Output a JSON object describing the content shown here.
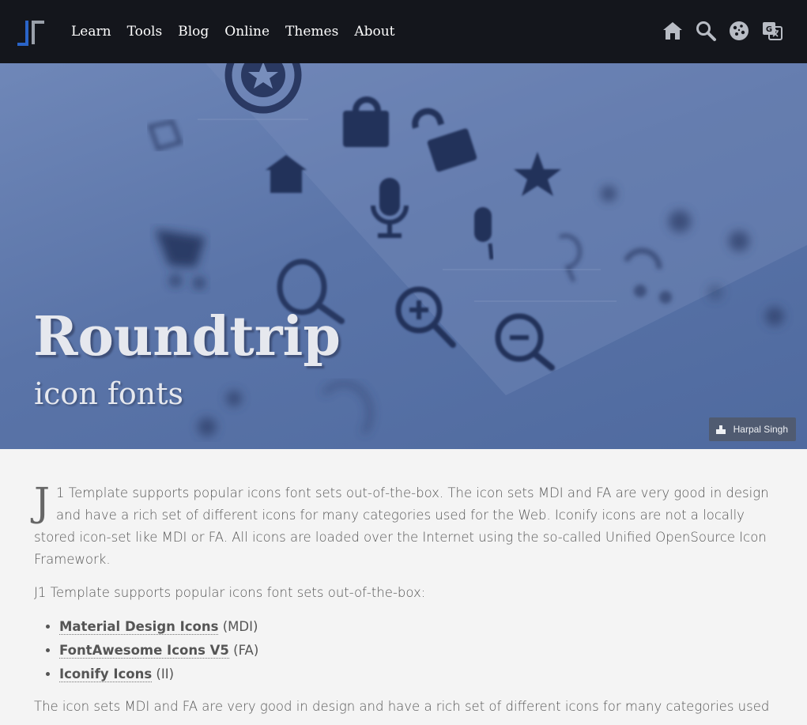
{
  "nav": {
    "links": [
      "Learn",
      "Tools",
      "Blog",
      "Online",
      "Themes",
      "About"
    ],
    "icons": [
      "home-icon",
      "search-icon",
      "cookie-icon",
      "translate-icon"
    ]
  },
  "hero": {
    "title": "Roundtrip",
    "subtitle": "icon fonts",
    "credit": "Harpal Singh"
  },
  "content": {
    "intro_dropcap": "J",
    "intro_rest": "1 Template supports popular icons font sets out-of-the-box. The icon sets MDI and FA are very good in design and have a rich set of different icons for many categories used for the Web. Iconify icons are not a locally stored icon-set like MDI or FA. All icons are loaded over the Internet using the so-called Unified OpenSource Icon Framework.",
    "para2": "J1 Template supports popular icons font sets out-of-the-box:",
    "list": [
      {
        "link": "Material Design Icons",
        "abbr": "(MDI)"
      },
      {
        "link": "FontAwesome Icons V5",
        "abbr": "(FA)"
      },
      {
        "link": "Iconify Icons",
        "abbr": "(II)"
      }
    ],
    "para3": "The icon sets MDI and FA are very good in design and have a rich set of different icons for many categories used"
  },
  "colors": {
    "navbar": "#14161c",
    "hero": "#5a74a8",
    "body_bg": "#f4f4f4",
    "text": "#555555"
  }
}
